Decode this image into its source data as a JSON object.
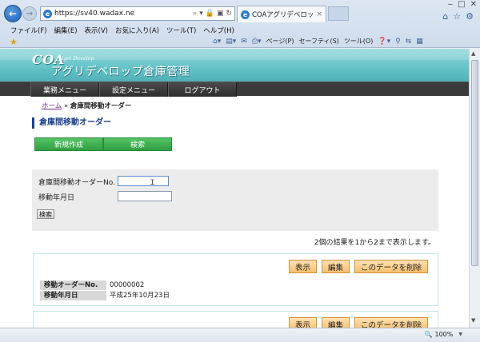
{
  "browser": {
    "address_url": "https://sv40.wadax.ne",
    "active_tab_title": "COAアグリデベロップ 倉...",
    "tab_close": "×",
    "menu": [
      "ファイル(F)",
      "編集(E)",
      "表示(V)",
      "お気に入り(A)",
      "ツール(T)",
      "ヘルプ(H)"
    ],
    "commands": {
      "page": "ページ(P)",
      "safety": "セーフティ(S)",
      "tools": "ツール(O)"
    },
    "zoom": "100%"
  },
  "site": {
    "logo_coa": "COA",
    "logo_sub": "Agri Develop",
    "logo_title": "アグリデベロップ倉庫管理",
    "nav": {
      "business": "業務メニュー",
      "settings": "設定メニュー",
      "logout": "ログアウト"
    }
  },
  "breadcrumb": {
    "home": "ホーム",
    "separator": "»",
    "current": "倉庫間移動オーダー"
  },
  "page_title": "倉庫間移動オーダー",
  "actions": {
    "new": "新規作成",
    "search": "検索"
  },
  "search_form": {
    "order_no_label": "倉庫間移動オーダーNo.",
    "order_no_value": "",
    "move_date_label": "移動年月日",
    "move_date_value": "",
    "submit": "検索"
  },
  "result_summary": "2個の結果を1から2まで表示します。",
  "results": [
    {
      "buttons": {
        "view": "表示",
        "edit": "編集",
        "delete": "このデータを削除"
      },
      "fields": {
        "order_no_label": "移動オーダーNo.",
        "order_no": "00000002",
        "move_date_label": "移動年月日",
        "move_date": "平成25年10月23日"
      }
    },
    {
      "buttons": {
        "view": "表示",
        "edit": "編集",
        "delete": "このデータを削除"
      }
    }
  ]
}
